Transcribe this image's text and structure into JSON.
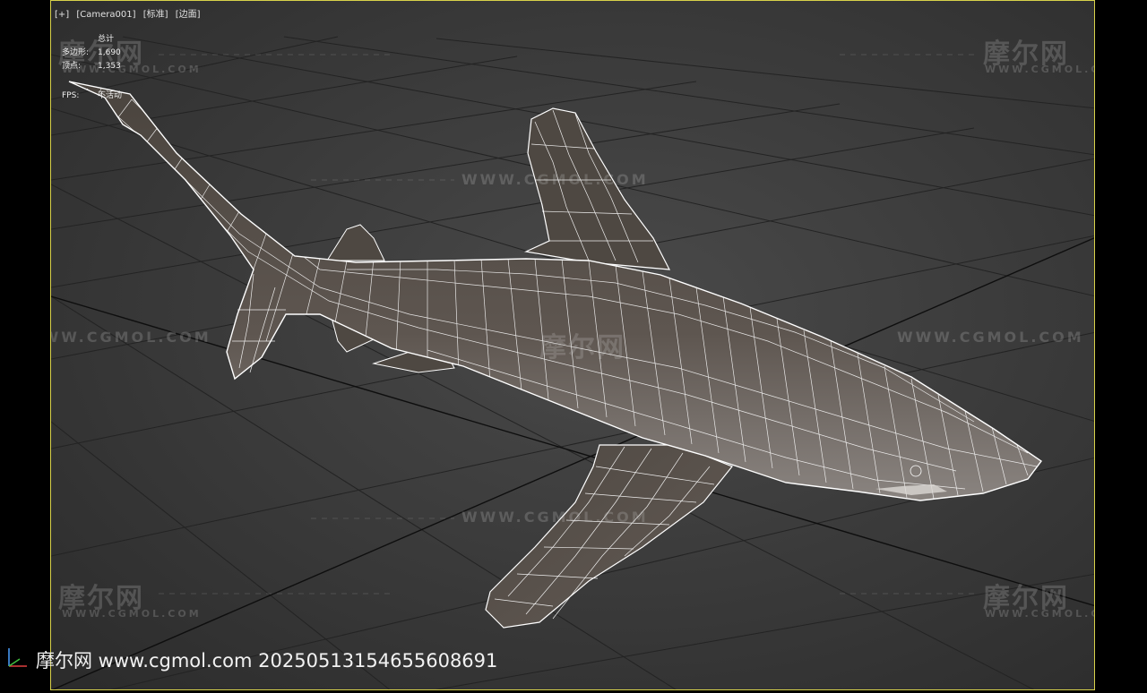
{
  "viewport": {
    "labels": [
      "[+]",
      "[Camera001]",
      "[标准]",
      "[边面]"
    ]
  },
  "stats": {
    "title": "总计",
    "polygons_label": "多边形:",
    "polygons_value": "1,690",
    "vertices_label": "顶点:",
    "vertices_value": "1,353",
    "fps_label": "FPS:",
    "fps_value": "不活动"
  },
  "watermark": {
    "brand": "摩尔网",
    "domain_small": "WWW.CGMOL.COM",
    "domain_line": "WWW.CGMOL.COM"
  },
  "footer": {
    "text": "摩尔网 www.cgmol.com 20250513154655608691"
  },
  "colors": {
    "viewport_border": "#d8d24a",
    "wireframe": "#ffffff",
    "shark_body": "#5a524a"
  },
  "icons": [
    "axis-gizmo-icon"
  ]
}
